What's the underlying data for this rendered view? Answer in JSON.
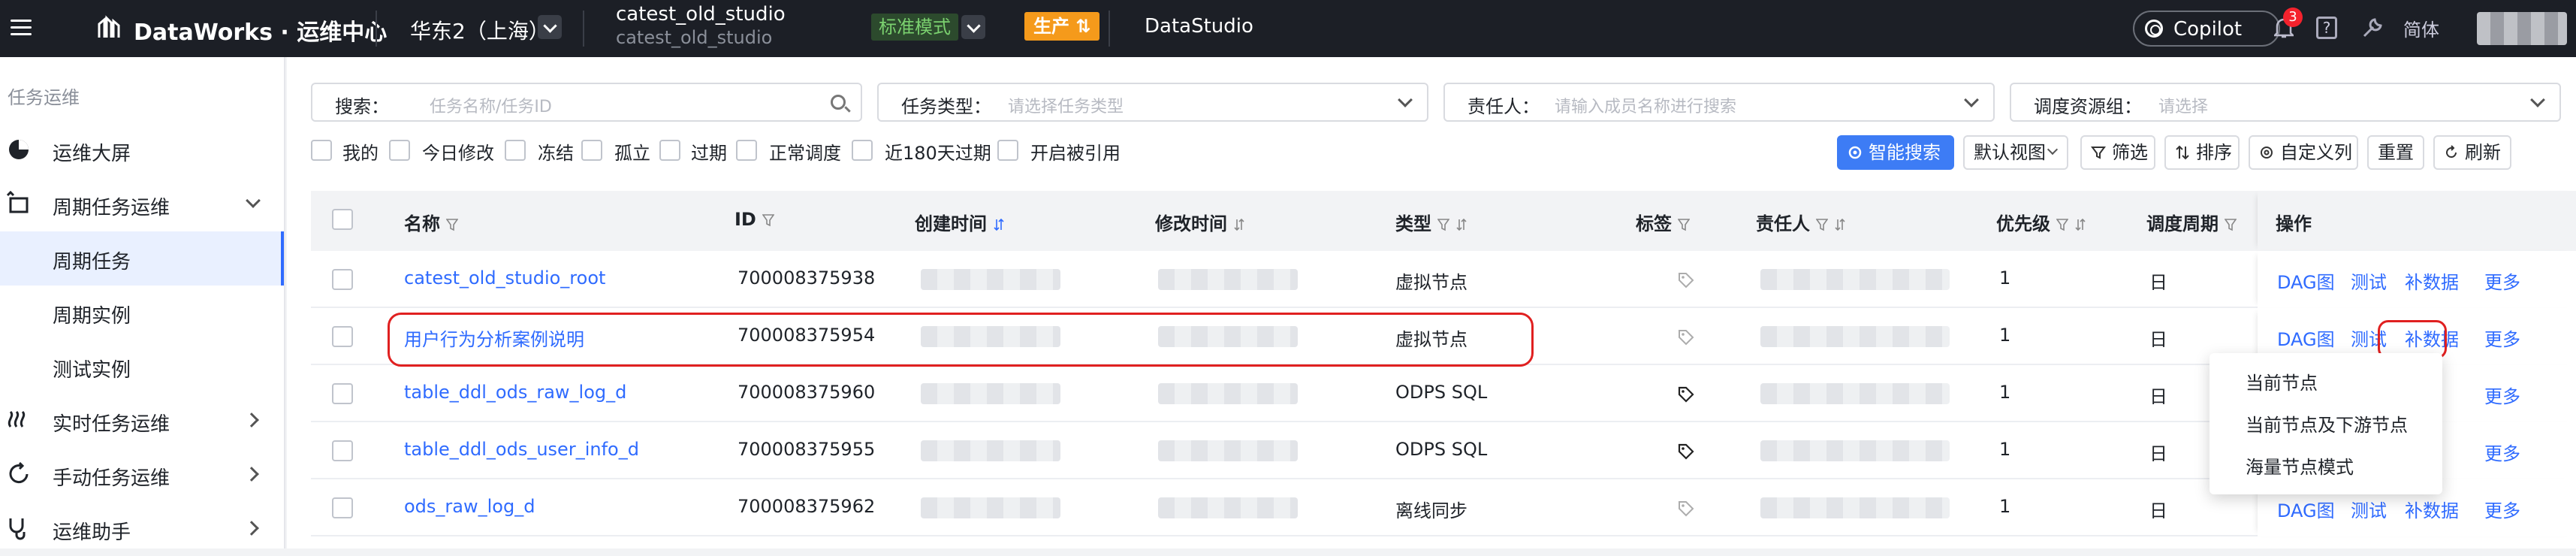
{
  "topbar": {
    "brand": "DataWorks · 运维中心",
    "region": "华东2（上海）",
    "workspace_name": "catest_old_studio",
    "workspace_sub": "catest_old_studio",
    "mode": "标准模式",
    "env": "生产",
    "module": "DataStudio",
    "copilot": "Copilot",
    "notifications": "3",
    "lang": "简体"
  },
  "sidebar": {
    "title": "任务运维",
    "items": [
      {
        "label": "运维大屏"
      },
      {
        "label": "周期任务运维"
      },
      {
        "label": "周期任务"
      },
      {
        "label": "周期实例"
      },
      {
        "label": "测试实例"
      },
      {
        "label": "实时任务运维"
      },
      {
        "label": "手动任务运维"
      },
      {
        "label": "运维助手"
      }
    ]
  },
  "filters": {
    "search_label": "搜索：",
    "search_placeholder": "任务名称/任务ID",
    "type_label": "任务类型：",
    "type_placeholder": "请选择任务类型",
    "owner_label": "责任人：",
    "owner_placeholder": "请输入成员名称进行搜索",
    "group_label": "调度资源组：",
    "group_placeholder": "请选择"
  },
  "checkboxes": [
    "我的",
    "今日修改",
    "冻结",
    "孤立",
    "过期",
    "正常调度",
    "近180天过期",
    "开启被引用"
  ],
  "toolbar": {
    "smart_search": "智能搜索",
    "default_view": "默认视图",
    "filter": "筛选",
    "sort": "排序",
    "custom_cols": "自定义列",
    "reset": "重置",
    "refresh": "刷新"
  },
  "table": {
    "columns": {
      "name": "名称",
      "id": "ID",
      "created": "创建时间",
      "modified": "修改时间",
      "type": "类型",
      "tags": "标签",
      "owner": "责任人",
      "priority": "优先级",
      "cycle": "调度周期",
      "ops": "操作"
    },
    "rows": [
      {
        "name": "catest_old_studio_root",
        "id": "700008375938",
        "type": "虚拟节点",
        "priority": "1",
        "cycle": "日"
      },
      {
        "name": "用户行为分析案例说明",
        "id": "700008375954",
        "type": "虚拟节点",
        "priority": "1",
        "cycle": "日"
      },
      {
        "name": "table_ddl_ods_raw_log_d",
        "id": "700008375960",
        "type": "ODPS SQL",
        "priority": "1",
        "cycle": "日"
      },
      {
        "name": "table_ddl_ods_user_info_d",
        "id": "700008375955",
        "type": "ODPS SQL",
        "priority": "1",
        "cycle": "日"
      },
      {
        "name": "ods_raw_log_d",
        "id": "700008375962",
        "type": "离线同步",
        "priority": "1",
        "cycle": "日"
      }
    ],
    "row_ops": {
      "dag": "DAG图",
      "test": "测试",
      "backfill": "补数据",
      "more": "更多"
    }
  },
  "backfill_menu": {
    "items": [
      "当前节点",
      "当前节点及下游节点",
      "海量节点模式"
    ]
  },
  "colors": {
    "topbar_bg": "#1c1f26",
    "accent": "#2f6bff",
    "highlight": "#e02020",
    "prod": "#f59a1b"
  }
}
